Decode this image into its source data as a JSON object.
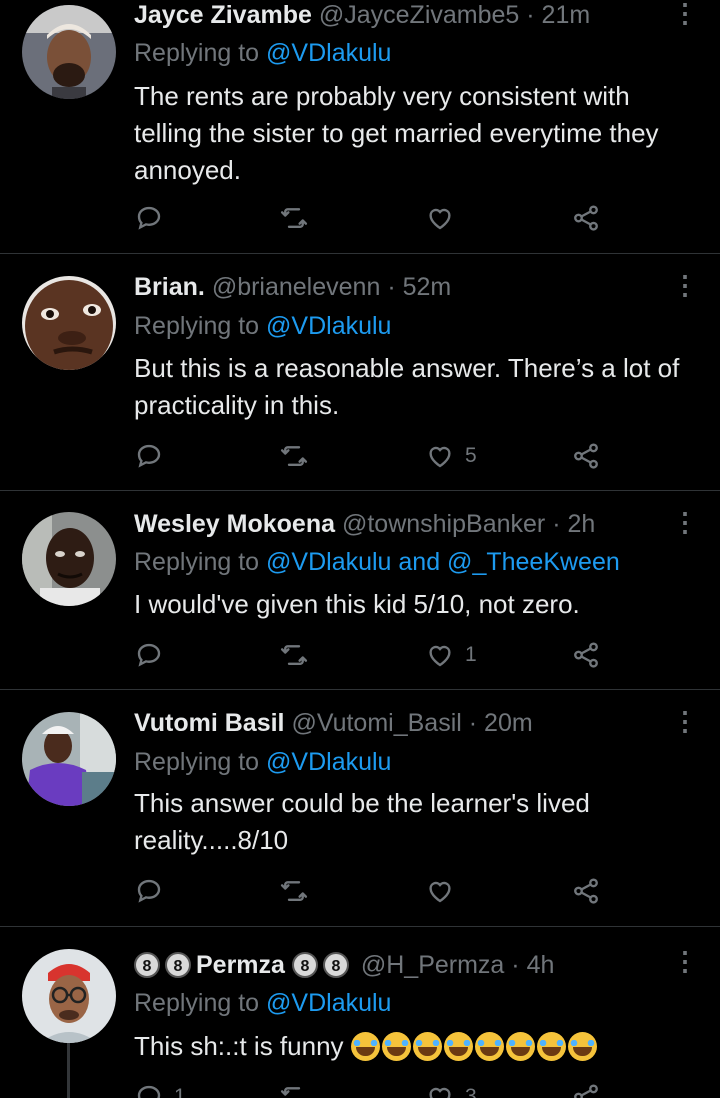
{
  "tweets": [
    {
      "name": "Jayce Zivambe",
      "handle": "@JayceZivambe5",
      "time": "21m",
      "replying_prefix": "Replying to",
      "mentions": "@VDlakulu",
      "text": "The rents are probably very consistent with telling the sister to get married everytime they annoyed.",
      "reply_count": "",
      "retweet_count": "",
      "like_count": ""
    },
    {
      "name": "Brian.",
      "handle": "@brianelevenn",
      "time": "52m",
      "replying_prefix": "Replying to",
      "mentions": "@VDlakulu",
      "text": "But this is a reasonable answer. There’s a lot of practicality in this.",
      "reply_count": "",
      "retweet_count": "",
      "like_count": "5"
    },
    {
      "name": "Wesley Mokoena",
      "handle": "@townshipBanker",
      "time": "2h",
      "replying_prefix": "Replying to",
      "mentions": "@VDlakulu and @_TheeKween",
      "text": "I would've given this kid 5/10, not zero.",
      "reply_count": "",
      "retweet_count": "",
      "like_count": "1"
    },
    {
      "name": "Vutomi Basil",
      "handle": "@Vutomi_Basil",
      "time": "20m",
      "replying_prefix": "Replying to",
      "mentions": "@VDlakulu",
      "text": "This answer could be the learner's lived reality.....8/10",
      "reply_count": "",
      "retweet_count": "",
      "like_count": ""
    },
    {
      "name_badge_left": "8",
      "name_badge_left2": "8",
      "name": "Permza",
      "name_badge_right": "8",
      "name_badge_right2": "8",
      "handle": "@H_Permza",
      "time": "4h",
      "replying_prefix": "Replying to",
      "mentions": "@VDlakulu",
      "text": "This sh:.:t is funny",
      "emoji_count": 8,
      "reply_count": "1",
      "retweet_count": "",
      "like_count": "3"
    }
  ],
  "separator": "·",
  "icons": {
    "more": "more-vertical-icon",
    "reply": "reply-bubble-icon",
    "retweet": "retweet-icon",
    "like": "heart-icon",
    "share": "share-nodes-icon",
    "emoji": "face-tears-of-joy-emoji"
  },
  "colors": {
    "background": "#000000",
    "text": "#e7e9ea",
    "secondary": "#71767b",
    "link": "#1d9bf0",
    "divider": "#2f3336"
  }
}
